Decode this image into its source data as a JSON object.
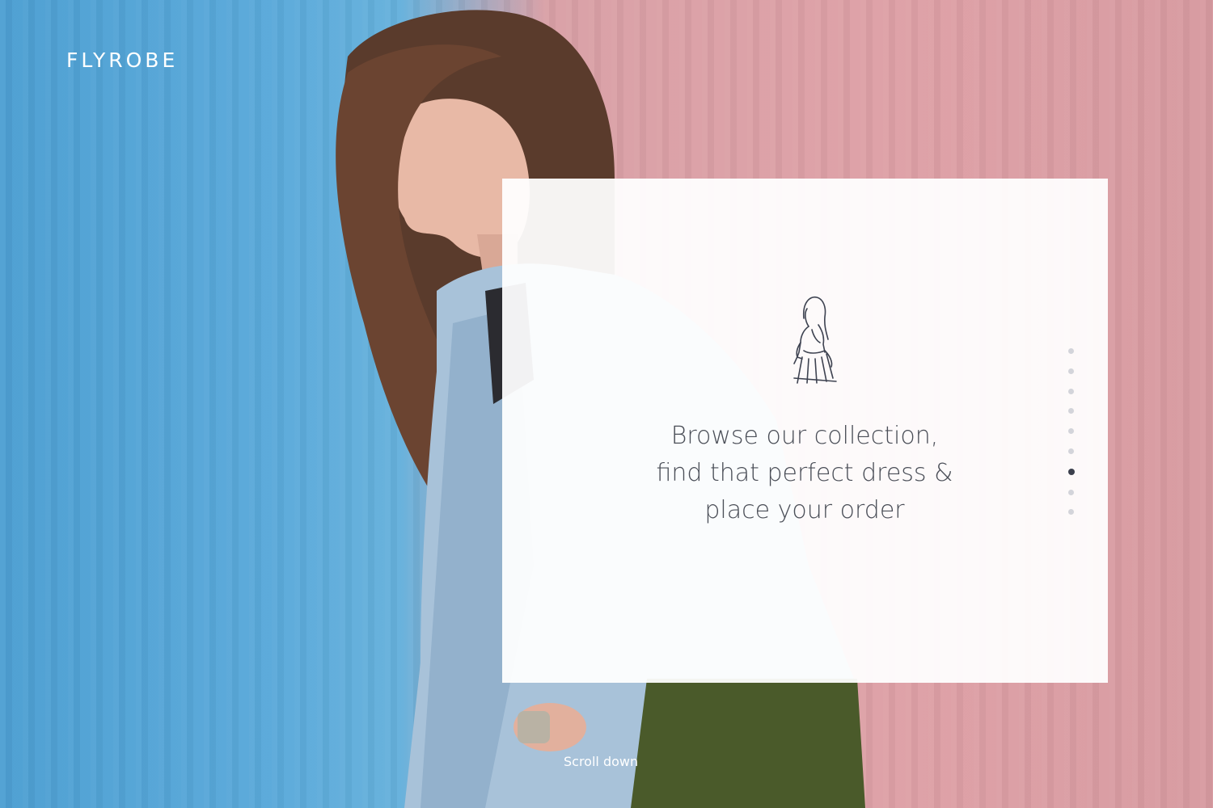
{
  "brand": {
    "logo_text": "FLYROBE"
  },
  "hero": {
    "image_description_icon": "woman-denim-jacket-photo"
  },
  "card": {
    "icon": "woman-silhouette-icon",
    "lines": [
      "Browse our collection,",
      "find that perfect dress &",
      "place your order"
    ]
  },
  "pagination": {
    "total": 9,
    "active_index": 6
  },
  "footer": {
    "scroll_label": "Scroll down"
  },
  "colors": {
    "left_wall": "#56a6d8",
    "right_wall": "#dba0a6",
    "card_bg": "#ffffff",
    "text": "#4a4e57",
    "dot_active": "#3b3f4c",
    "dot_inactive": "#d3d4da"
  }
}
